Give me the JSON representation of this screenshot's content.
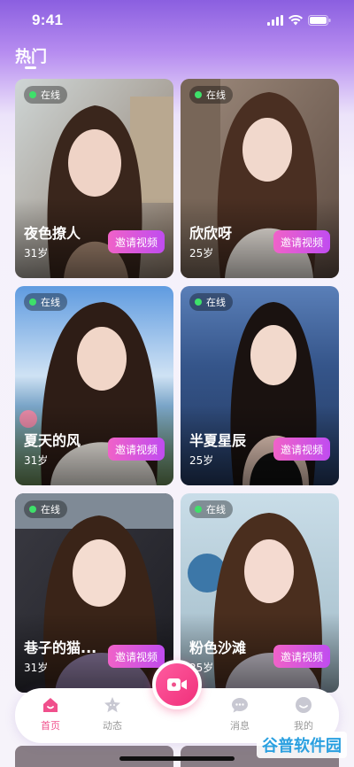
{
  "status_bar": {
    "time": "9:41"
  },
  "section_title": "热门",
  "online_label": "在线",
  "invite_label": "邀请视频",
  "cards": [
    {
      "name": "夜色撩人",
      "age": "31岁"
    },
    {
      "name": "欣欣呀",
      "age": "25岁"
    },
    {
      "name": "夏天的风",
      "age": "31岁"
    },
    {
      "name": "半夏星辰",
      "age": "25岁"
    },
    {
      "name": "巷子的猫...",
      "age": "31岁"
    },
    {
      "name": "粉色沙滩",
      "age": "25岁"
    }
  ],
  "tabbar": {
    "home": "首页",
    "moments": "动态",
    "messages": "消息",
    "mine": "我的"
  },
  "watermark": "谷普软件园",
  "colors": {
    "accent": "#f0508c",
    "invite_gradient_start": "#f062c8",
    "invite_gradient_end": "#c04cf0",
    "online_dot": "#3ee06a"
  }
}
